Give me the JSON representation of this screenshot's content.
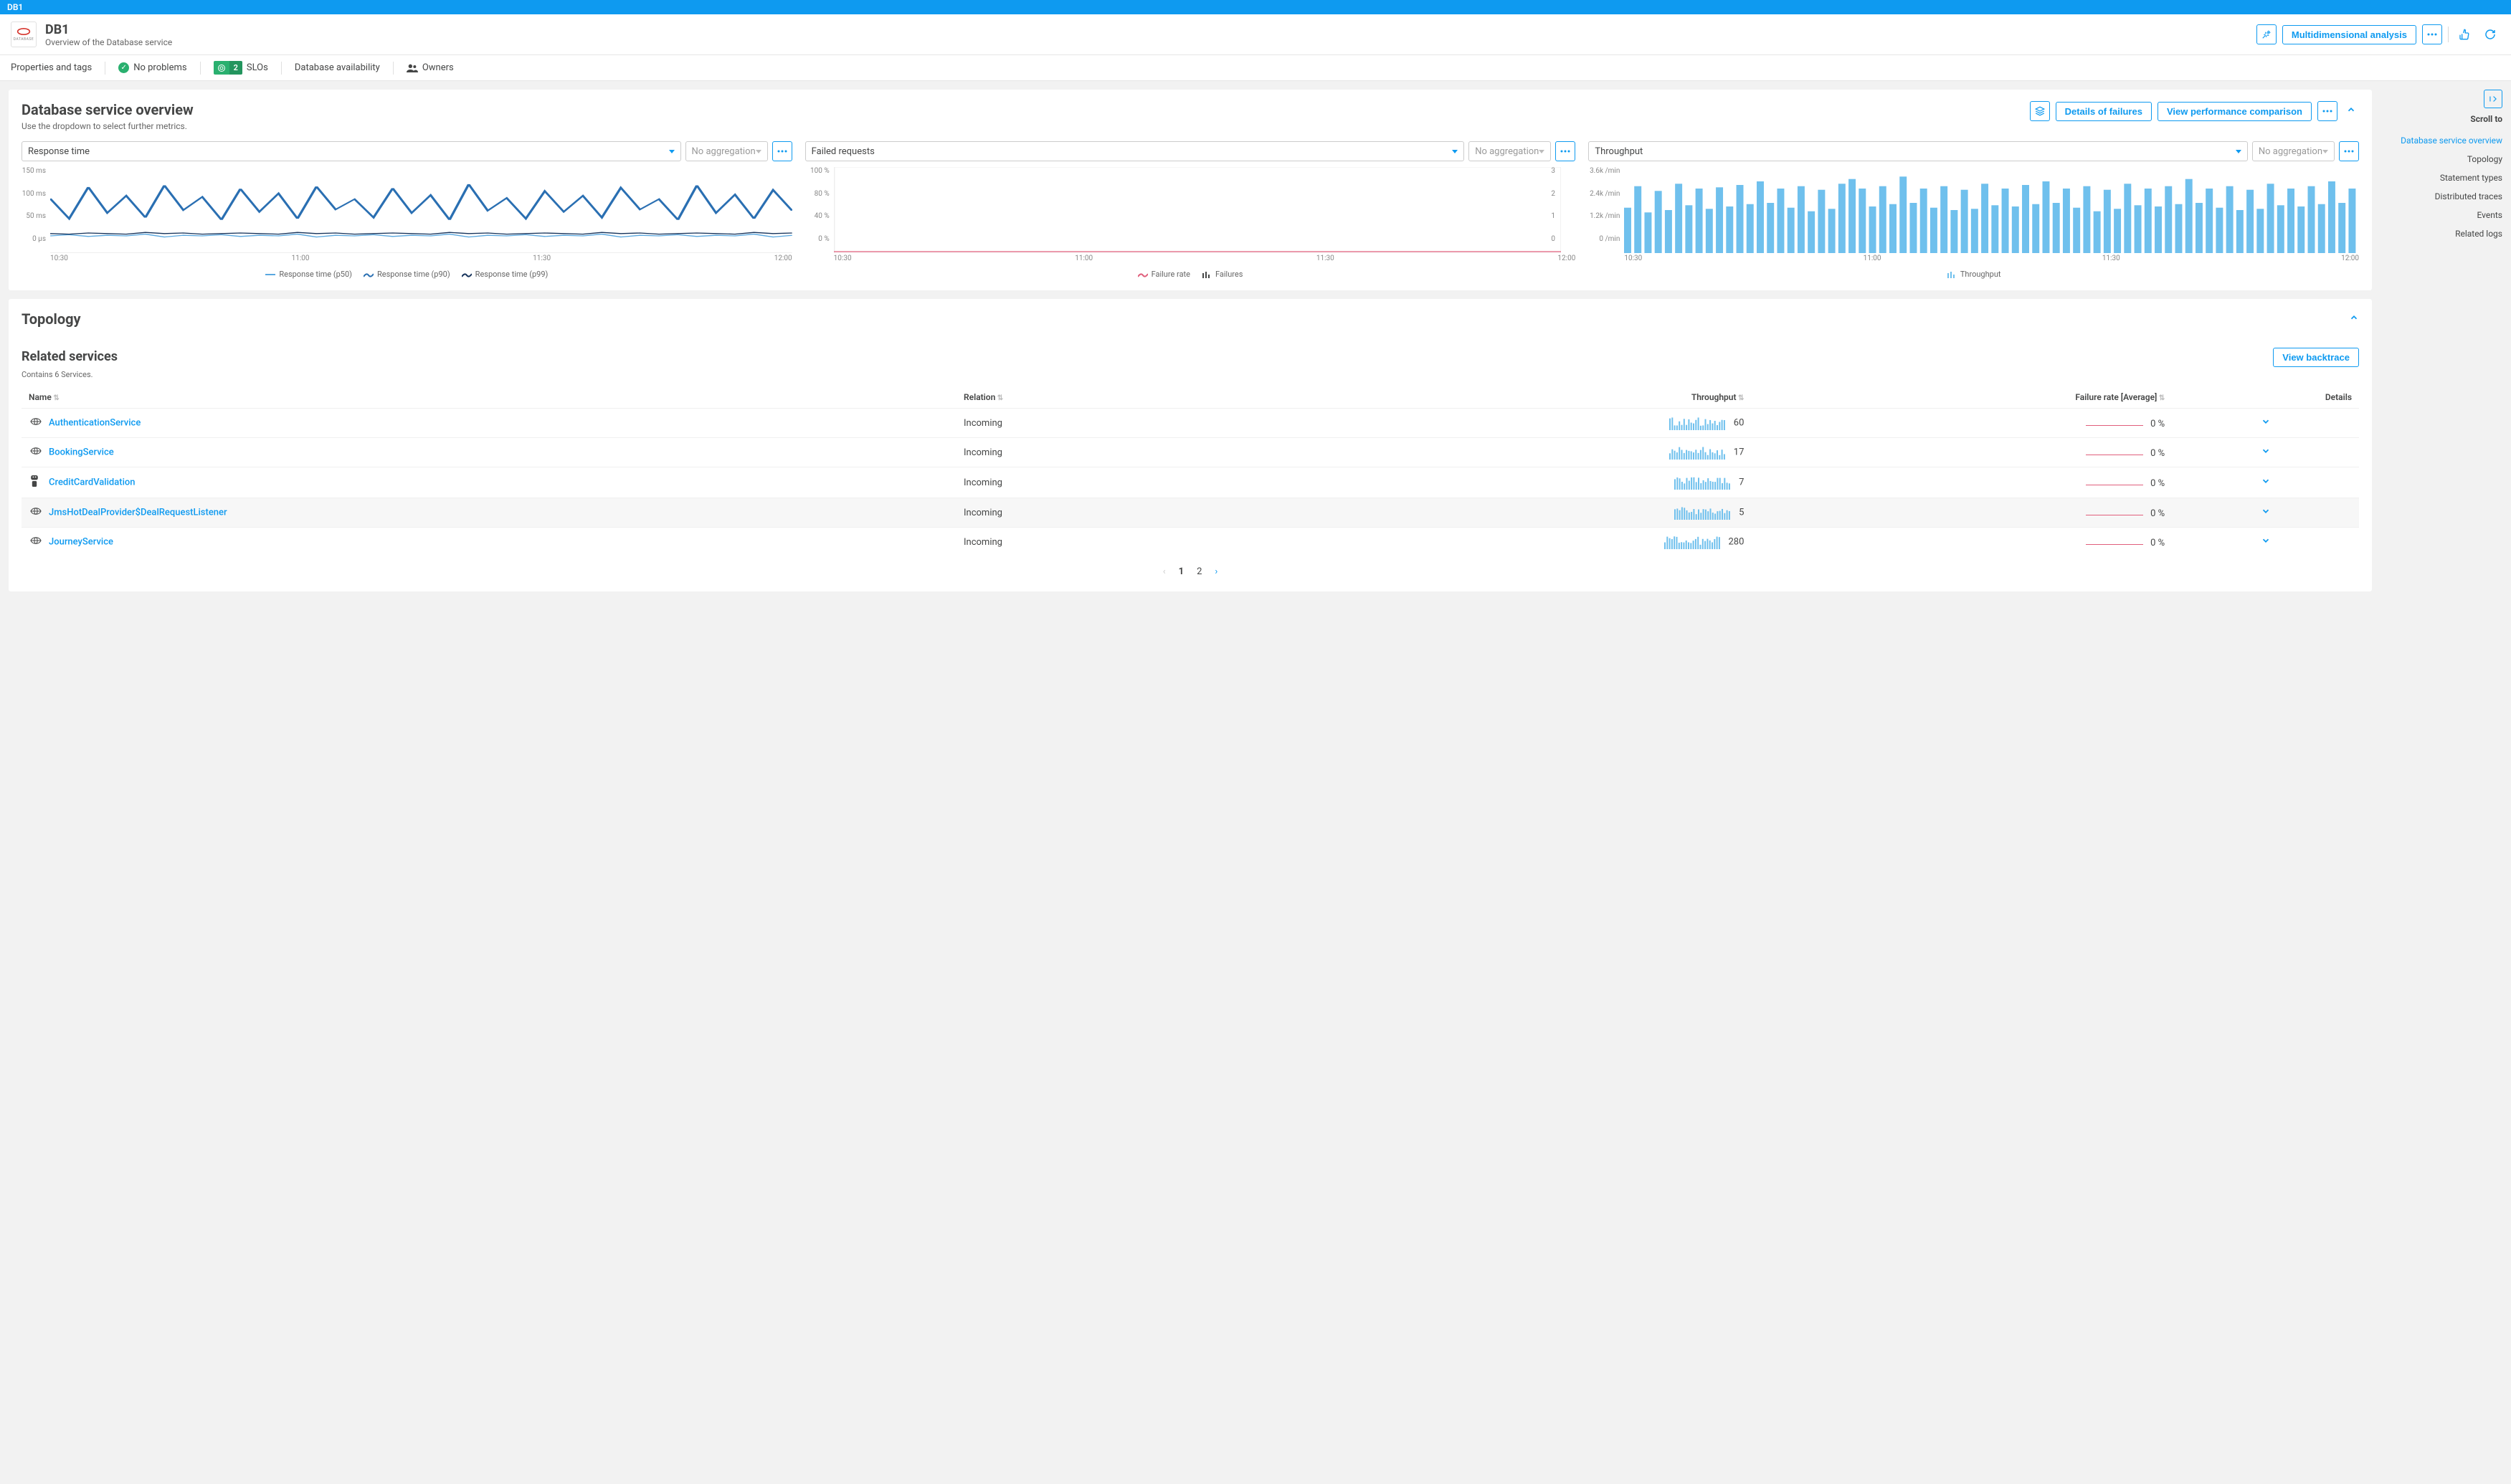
{
  "breadcrumb": "DB1",
  "header": {
    "title": "DB1",
    "subtitle": "Overview of the Database service",
    "db_tile_label": "DATABASE",
    "multi_analysis": "Multidimensional analysis"
  },
  "subnav": {
    "props_tags": "Properties and tags",
    "no_problems": "No problems",
    "slos_count": "2",
    "slos_label": "SLOs",
    "db_avail": "Database availability",
    "owners": "Owners"
  },
  "overview": {
    "title": "Database service overview",
    "hint": "Use the dropdown to select further metrics.",
    "details_btn": "Details of failures",
    "compare_btn": "View performance comparison",
    "no_agg": "No aggregation",
    "charts": [
      {
        "selector": "Response time"
      },
      {
        "selector": "Failed requests"
      },
      {
        "selector": "Throughput"
      }
    ],
    "legends": {
      "rt": [
        "Response time (p50)",
        "Response time (p90)",
        "Response time (p99)"
      ],
      "fr": [
        "Failure rate",
        "Failures"
      ],
      "tp": [
        "Throughput"
      ]
    }
  },
  "chart_data": [
    {
      "type": "line",
      "title": "Response time",
      "xlabel": "",
      "ylabel": "",
      "x_ticks": [
        "10:30",
        "11:00",
        "11:30",
        "12:00"
      ],
      "y_ticks": [
        "150 ms",
        "100 ms",
        "50 ms",
        "0 µs"
      ],
      "ylim": [
        0,
        150
      ],
      "series": [
        {
          "name": "Response time (p50)",
          "color": "#5aa8e0",
          "values": [
            30,
            32,
            29,
            31,
            30,
            33,
            28,
            31,
            30,
            32,
            29,
            31,
            30,
            33,
            28,
            31,
            30,
            32,
            29,
            31,
            30,
            33,
            28,
            31,
            30,
            32,
            29,
            31,
            30,
            33,
            28,
            31,
            30,
            32,
            29,
            31,
            30,
            33,
            28,
            31
          ]
        },
        {
          "name": "Response time (p90)",
          "color": "#2a6fb2",
          "values": [
            95,
            60,
            115,
            70,
            100,
            62,
            118,
            75,
            98,
            58,
            112,
            72,
            104,
            60,
            116,
            76,
            94,
            62,
            113,
            70,
            101,
            58,
            120,
            74,
            96,
            60,
            108,
            72,
            100,
            62,
            114,
            76,
            94,
            58,
            118,
            70,
            102,
            60,
            110,
            74
          ]
        },
        {
          "name": "Response time (p99)",
          "color": "#16335b",
          "values": [
            34,
            33,
            35,
            34,
            33,
            36,
            34,
            35,
            33,
            34,
            35,
            34,
            33,
            36,
            34,
            35,
            33,
            34,
            35,
            34,
            33,
            36,
            34,
            35,
            33,
            34,
            35,
            34,
            33,
            36,
            34,
            35,
            33,
            34,
            35,
            34,
            33,
            36,
            34,
            35
          ]
        }
      ]
    },
    {
      "type": "line",
      "title": "Failed requests",
      "x_ticks": [
        "10:30",
        "11:00",
        "11:30",
        "12:00"
      ],
      "y_left_ticks": [
        "100 %",
        "80 %",
        "40 %",
        "0 %"
      ],
      "y_right_ticks": [
        "3",
        "2",
        "1",
        "0"
      ],
      "ylim_left": [
        0,
        100
      ],
      "ylim_right": [
        0,
        3
      ],
      "series": [
        {
          "name": "Failure rate",
          "color": "#e05f7c",
          "values": [
            0,
            0,
            0,
            0,
            0,
            0,
            0,
            0,
            0,
            0,
            0,
            0,
            0,
            0,
            0,
            0,
            0,
            0,
            0,
            0,
            0,
            0,
            0,
            0,
            0,
            0,
            0,
            0,
            0,
            0,
            0,
            0,
            0,
            0,
            0,
            0,
            0,
            0,
            0,
            0
          ]
        },
        {
          "name": "Failures",
          "color": "#454646",
          "values": [
            0,
            0,
            0,
            0,
            0,
            0,
            0,
            0,
            0,
            0,
            0,
            0,
            0,
            0,
            0,
            0,
            0,
            0,
            0,
            0,
            0,
            0,
            0,
            0,
            0,
            0,
            0,
            0,
            0,
            0,
            0,
            0,
            0,
            0,
            0,
            0,
            0,
            0,
            0,
            0
          ]
        }
      ]
    },
    {
      "type": "bar",
      "title": "Throughput",
      "x_ticks": [
        "10:30",
        "11:00",
        "11:30",
        "12:00"
      ],
      "y_ticks": [
        "3.6k /min",
        "2.4k /min",
        "1.2k /min",
        "0 /min"
      ],
      "ylim": [
        0,
        3600
      ],
      "series": [
        {
          "name": "Throughput",
          "color": "#6fc0ed",
          "values": [
            1900,
            2800,
            1700,
            2600,
            1800,
            2900,
            2000,
            2700,
            1850,
            2750,
            1950,
            2850,
            2050,
            3000,
            2100,
            2700,
            1900,
            2800,
            1750,
            2650,
            1850,
            2900,
            3100,
            2700,
            1950,
            2800,
            2050,
            3200,
            2100,
            2700,
            1900,
            2800,
            1800,
            2650,
            1850,
            2900,
            2000,
            2700,
            1950,
            2850,
            2050,
            3000,
            2100,
            2700,
            1900,
            2800,
            1750,
            2650,
            1850,
            2900,
            2000,
            2700,
            1950,
            2800,
            2050,
            3100,
            2100,
            2700,
            1900,
            2800,
            1800,
            2650,
            1850,
            2900,
            2000,
            2700,
            1950,
            2800,
            2050,
            3000,
            2100,
            2700
          ]
        }
      ]
    }
  ],
  "sidenav": {
    "label": "Scroll to",
    "items": [
      {
        "label": "Database service overview",
        "active": true
      },
      {
        "label": "Topology"
      },
      {
        "label": "Statement types"
      },
      {
        "label": "Distributed traces"
      },
      {
        "label": "Events"
      },
      {
        "label": "Related logs"
      }
    ]
  },
  "topology": {
    "title": "Topology",
    "related_title": "Related services",
    "related_sub": "Contains 6 Services.",
    "backtrace_btn": "View backtrace",
    "columns": {
      "name": "Name",
      "relation": "Relation",
      "throughput": "Throughput",
      "failure": "Failure rate [Average]",
      "details": "Details"
    },
    "rows": [
      {
        "name": "AuthenticationService",
        "relation": "Incoming",
        "throughput": 60,
        "failure": "0 %",
        "icon": "service"
      },
      {
        "name": "BookingService",
        "relation": "Incoming",
        "throughput": 17,
        "failure": "0 %",
        "icon": "service"
      },
      {
        "name": "CreditCardValidation",
        "relation": "Incoming",
        "throughput": 7,
        "failure": "0 %",
        "icon": "agent"
      },
      {
        "name": "JmsHotDealProvider$DealRequestListener",
        "relation": "Incoming",
        "throughput": 5,
        "failure": "0 %",
        "icon": "service",
        "hover": true
      },
      {
        "name": "JourneyService",
        "relation": "Incoming",
        "throughput": 280,
        "failure": "0 %",
        "icon": "service"
      }
    ],
    "pages": [
      "1",
      "2"
    ],
    "current_page": "1"
  }
}
